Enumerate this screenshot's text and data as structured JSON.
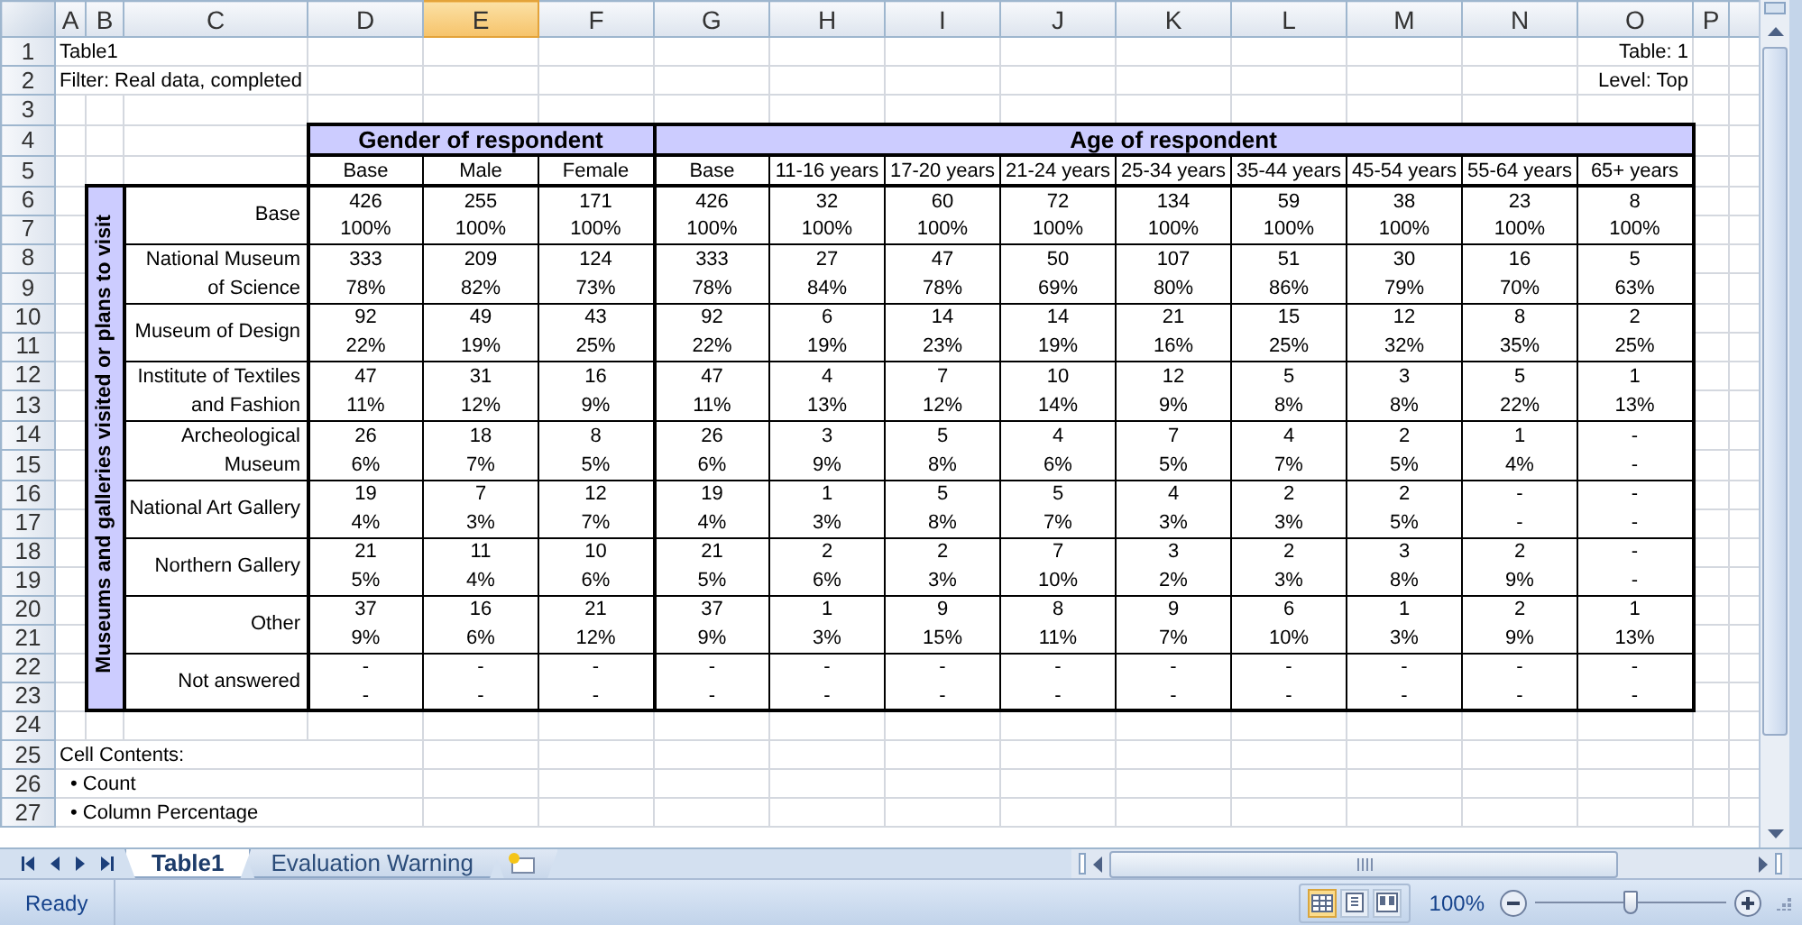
{
  "columns": [
    {
      "label": "A",
      "selected": false
    },
    {
      "label": "B",
      "selected": false
    },
    {
      "label": "C",
      "selected": false
    },
    {
      "label": "D",
      "selected": false
    },
    {
      "label": "E",
      "selected": true
    },
    {
      "label": "F",
      "selected": false
    },
    {
      "label": "G",
      "selected": false
    },
    {
      "label": "H",
      "selected": false
    },
    {
      "label": "I",
      "selected": false
    },
    {
      "label": "J",
      "selected": false
    },
    {
      "label": "K",
      "selected": false
    },
    {
      "label": "L",
      "selected": false
    },
    {
      "label": "M",
      "selected": false
    },
    {
      "label": "N",
      "selected": false
    },
    {
      "label": "O",
      "selected": false
    },
    {
      "label": "P",
      "selected": false
    }
  ],
  "row_numbers": [
    "1",
    "2",
    "3",
    "4",
    "5",
    "6",
    "7",
    "8",
    "9",
    "10",
    "11",
    "12",
    "13",
    "14",
    "15",
    "16",
    "17",
    "18",
    "19",
    "20",
    "21",
    "22",
    "23",
    "24",
    "25",
    "26",
    "27"
  ],
  "title": "Table1",
  "filter": "Filter: Real data, completed",
  "table_label": "Table: 1",
  "level_label": "Level: Top",
  "crosstab": {
    "side_label": "Museums and galleries visited or plans to visit",
    "groups": [
      {
        "label": "Gender of respondent",
        "columns": [
          "Base",
          "Male",
          "Female"
        ]
      },
      {
        "label": "Age of respondent",
        "columns": [
          "Base",
          "11-16 years",
          "17-20 years",
          "21-24 years",
          "25-34 years",
          "35-44 years",
          "45-54 years",
          "55-64 years",
          "65+ years"
        ]
      }
    ],
    "rows": [
      {
        "label": "Base",
        "counts": [
          "426",
          "255",
          "171",
          "426",
          "32",
          "60",
          "72",
          "134",
          "59",
          "38",
          "23",
          "8"
        ],
        "percents": [
          "100%",
          "100%",
          "100%",
          "100%",
          "100%",
          "100%",
          "100%",
          "100%",
          "100%",
          "100%",
          "100%",
          "100%"
        ]
      },
      {
        "label": "National Museum of Science",
        "counts": [
          "333",
          "209",
          "124",
          "333",
          "27",
          "47",
          "50",
          "107",
          "51",
          "30",
          "16",
          "5"
        ],
        "percents": [
          "78%",
          "82%",
          "73%",
          "78%",
          "84%",
          "78%",
          "69%",
          "80%",
          "86%",
          "79%",
          "70%",
          "63%"
        ]
      },
      {
        "label": "Museum of Design",
        "counts": [
          "92",
          "49",
          "43",
          "92",
          "6",
          "14",
          "14",
          "21",
          "15",
          "12",
          "8",
          "2"
        ],
        "percents": [
          "22%",
          "19%",
          "25%",
          "22%",
          "19%",
          "23%",
          "19%",
          "16%",
          "25%",
          "32%",
          "35%",
          "25%"
        ]
      },
      {
        "label": "Institute of Textiles and Fashion",
        "counts": [
          "47",
          "31",
          "16",
          "47",
          "4",
          "7",
          "10",
          "12",
          "5",
          "3",
          "5",
          "1"
        ],
        "percents": [
          "11%",
          "12%",
          "9%",
          "11%",
          "13%",
          "12%",
          "14%",
          "9%",
          "8%",
          "8%",
          "22%",
          "13%"
        ]
      },
      {
        "label": "Archeological Museum",
        "counts": [
          "26",
          "18",
          "8",
          "26",
          "3",
          "5",
          "4",
          "7",
          "4",
          "2",
          "1",
          "-"
        ],
        "percents": [
          "6%",
          "7%",
          "5%",
          "6%",
          "9%",
          "8%",
          "6%",
          "5%",
          "7%",
          "5%",
          "4%",
          "-"
        ]
      },
      {
        "label": "National Art Gallery",
        "counts": [
          "19",
          "7",
          "12",
          "19",
          "1",
          "5",
          "5",
          "4",
          "2",
          "2",
          "-",
          "-"
        ],
        "percents": [
          "4%",
          "3%",
          "7%",
          "4%",
          "3%",
          "8%",
          "7%",
          "3%",
          "3%",
          "5%",
          "-",
          "-"
        ]
      },
      {
        "label": "Northern Gallery",
        "counts": [
          "21",
          "11",
          "10",
          "21",
          "2",
          "2",
          "7",
          "3",
          "2",
          "3",
          "2",
          "-"
        ],
        "percents": [
          "5%",
          "4%",
          "6%",
          "5%",
          "6%",
          "3%",
          "10%",
          "2%",
          "3%",
          "8%",
          "9%",
          "-"
        ]
      },
      {
        "label": "Other",
        "counts": [
          "37",
          "16",
          "21",
          "37",
          "1",
          "9",
          "8",
          "9",
          "6",
          "1",
          "2",
          "1"
        ],
        "percents": [
          "9%",
          "6%",
          "12%",
          "9%",
          "3%",
          "15%",
          "11%",
          "7%",
          "10%",
          "3%",
          "9%",
          "13%"
        ]
      },
      {
        "label": "Not answered",
        "counts": [
          "-",
          "-",
          "-",
          "-",
          "-",
          "-",
          "-",
          "-",
          "-",
          "-",
          "-",
          "-"
        ],
        "percents": [
          "-",
          "-",
          "-",
          "-",
          "-",
          "-",
          "-",
          "-",
          "-",
          "-",
          "-",
          "-"
        ]
      }
    ]
  },
  "notes": [
    "Cell Contents:",
    "• Count",
    "• Column Percentage"
  ],
  "sheet_tabs": [
    {
      "label": "Table1",
      "selected": true
    },
    {
      "label": "Evaluation Warning",
      "selected": false
    }
  ],
  "status_bar": {
    "status": "Ready",
    "view_buttons": [
      {
        "kind": "normal",
        "selected": true
      },
      {
        "kind": "page_layout",
        "selected": false
      },
      {
        "kind": "page_break",
        "selected": false
      }
    ],
    "zoom": "100%",
    "zoom_slider": {
      "level": 0.5
    }
  }
}
